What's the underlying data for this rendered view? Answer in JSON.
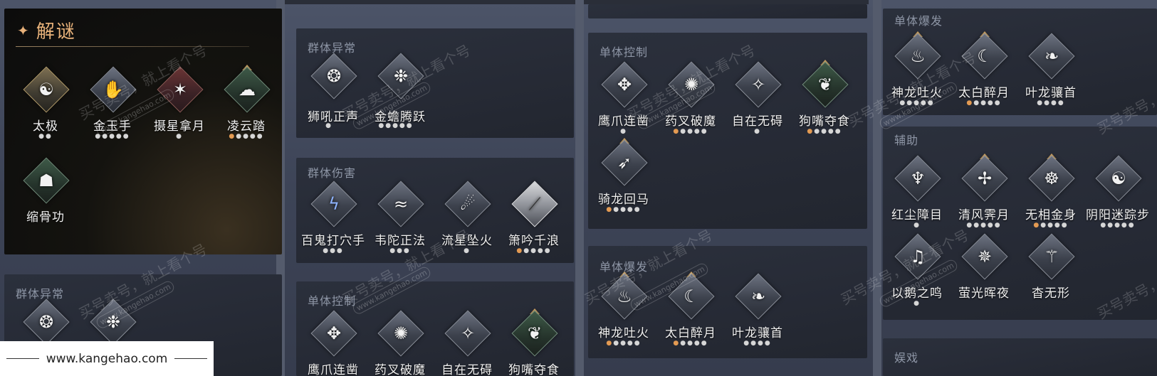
{
  "colors": {
    "accent": "#e8b27a",
    "dot_orange": "#e39a52",
    "panel": "#272b36"
  },
  "puzzle": {
    "title": "解谜",
    "skills": [
      {
        "name": "太极",
        "icon": "taiji-figure-icon",
        "dots": "●●"
      },
      {
        "name": "金玉手",
        "icon": "jade-hand-icon",
        "dots": "●●●●●"
      },
      {
        "name": "摄星拿月",
        "icon": "star-grab-icon",
        "dots": "●"
      },
      {
        "name": "凌云踏",
        "icon": "cloud-step-icon",
        "dots_orange": "●",
        "dots": "●●●●"
      },
      {
        "name": "缩骨功",
        "icon": "bone-shrink-icon",
        "dots": ""
      }
    ]
  },
  "col1_bottom": {
    "title": "群体异常"
  },
  "col2": {
    "group_abnormal": {
      "title": "群体异常",
      "skills": [
        {
          "name": "狮吼正声",
          "icon": "lion-roar-icon",
          "dots": "●"
        },
        {
          "name": "金蟾腾跃",
          "icon": "golden-toad-icon",
          "dots": "●●●●●"
        }
      ]
    },
    "group_damage": {
      "title": "群体伤害",
      "skills": [
        {
          "name": "百鬼打穴手",
          "icon": "ghost-strike-icon",
          "dots": "●●●"
        },
        {
          "name": "韦陀正法",
          "icon": "weituo-icon",
          "dots": "●●●"
        },
        {
          "name": "流星坠火",
          "icon": "meteor-fire-icon",
          "dots": "●"
        },
        {
          "name": "箫吟千浪",
          "icon": "flute-wave-icon",
          "dots_orange": "●",
          "dots": "●●●●"
        }
      ]
    },
    "single_control": {
      "title": "单体控制",
      "skills": [
        {
          "name": "鹰爪连凿",
          "icon": "eagle-claw-icon",
          "dots": ""
        },
        {
          "name": "药叉破魔",
          "icon": "yaksha-icon",
          "dots": ""
        },
        {
          "name": "自在无碍",
          "icon": "free-flow-icon",
          "dots": ""
        },
        {
          "name": "狗嘴夺食",
          "icon": "dog-snatch-icon",
          "dots": ""
        }
      ]
    }
  },
  "col3": {
    "single_control": {
      "title": "单体控制",
      "skills": [
        {
          "name": "鹰爪连凿",
          "icon": "eagle-claw-icon",
          "dots": "●"
        },
        {
          "name": "药叉破魔",
          "icon": "yaksha-icon",
          "dots_orange": "●",
          "dots": "●●●●"
        },
        {
          "name": "自在无碍",
          "icon": "free-flow-icon",
          "dots": "●"
        },
        {
          "name": "狗嘴夺食",
          "icon": "dog-snatch-icon",
          "dots_orange": "●",
          "dots": "●●●●"
        },
        {
          "name": "骑龙回马",
          "icon": "dragon-ride-icon",
          "dots_orange": "●",
          "dots": "●●●●"
        }
      ]
    },
    "single_burst": {
      "title": "单体爆发",
      "skills": [
        {
          "name": "神龙吐火",
          "icon": "dragon-fire-icon",
          "dots_orange": "●",
          "dots": "●●●●"
        },
        {
          "name": "太白醉月",
          "icon": "drunk-moon-icon",
          "dots_orange": "●",
          "dots": "●●●●"
        },
        {
          "name": "叶龙骧首",
          "icon": "leaf-dragon-icon",
          "dots": "●●●●"
        }
      ]
    }
  },
  "col4": {
    "single_burst": {
      "title": "单体爆发",
      "skills": [
        {
          "name": "神龙吐火",
          "icon": "dragon-fire-icon",
          "dots": "●●●●●"
        },
        {
          "name": "太白醉月",
          "icon": "drunk-moon-icon",
          "dots_orange": "●",
          "dots": "●●●●"
        },
        {
          "name": "叶龙骧首",
          "icon": "leaf-dragon-icon",
          "dots": "●●●●"
        }
      ]
    },
    "support": {
      "title": "辅助",
      "skills": [
        {
          "name": "红尘障目",
          "icon": "red-dust-icon",
          "dots": "●"
        },
        {
          "name": "清风霁月",
          "icon": "breeze-moon-icon",
          "dots": "●●●●●"
        },
        {
          "name": "无相金身",
          "icon": "golden-body-icon",
          "dots_orange": "●",
          "dots": "●●●●"
        },
        {
          "name": "阴阳迷踪步",
          "icon": "yinyang-icon",
          "dots": "●●●●●"
        },
        {
          "name": "以鹅之鸣",
          "icon": "goose-call-icon",
          "dots": "●"
        },
        {
          "name": "萤光晖夜",
          "icon": "firefly-icon",
          "dots": ""
        },
        {
          "name": "杳无形",
          "icon": "vanish-icon",
          "dots": ""
        }
      ]
    },
    "play": {
      "title": "娱戏"
    }
  },
  "watermark": {
    "text": "买号卖号，就上看个号",
    "url": "www.kangehao.com",
    "tag": "看个号"
  },
  "footer": {
    "url": "www.kangehao.com"
  }
}
